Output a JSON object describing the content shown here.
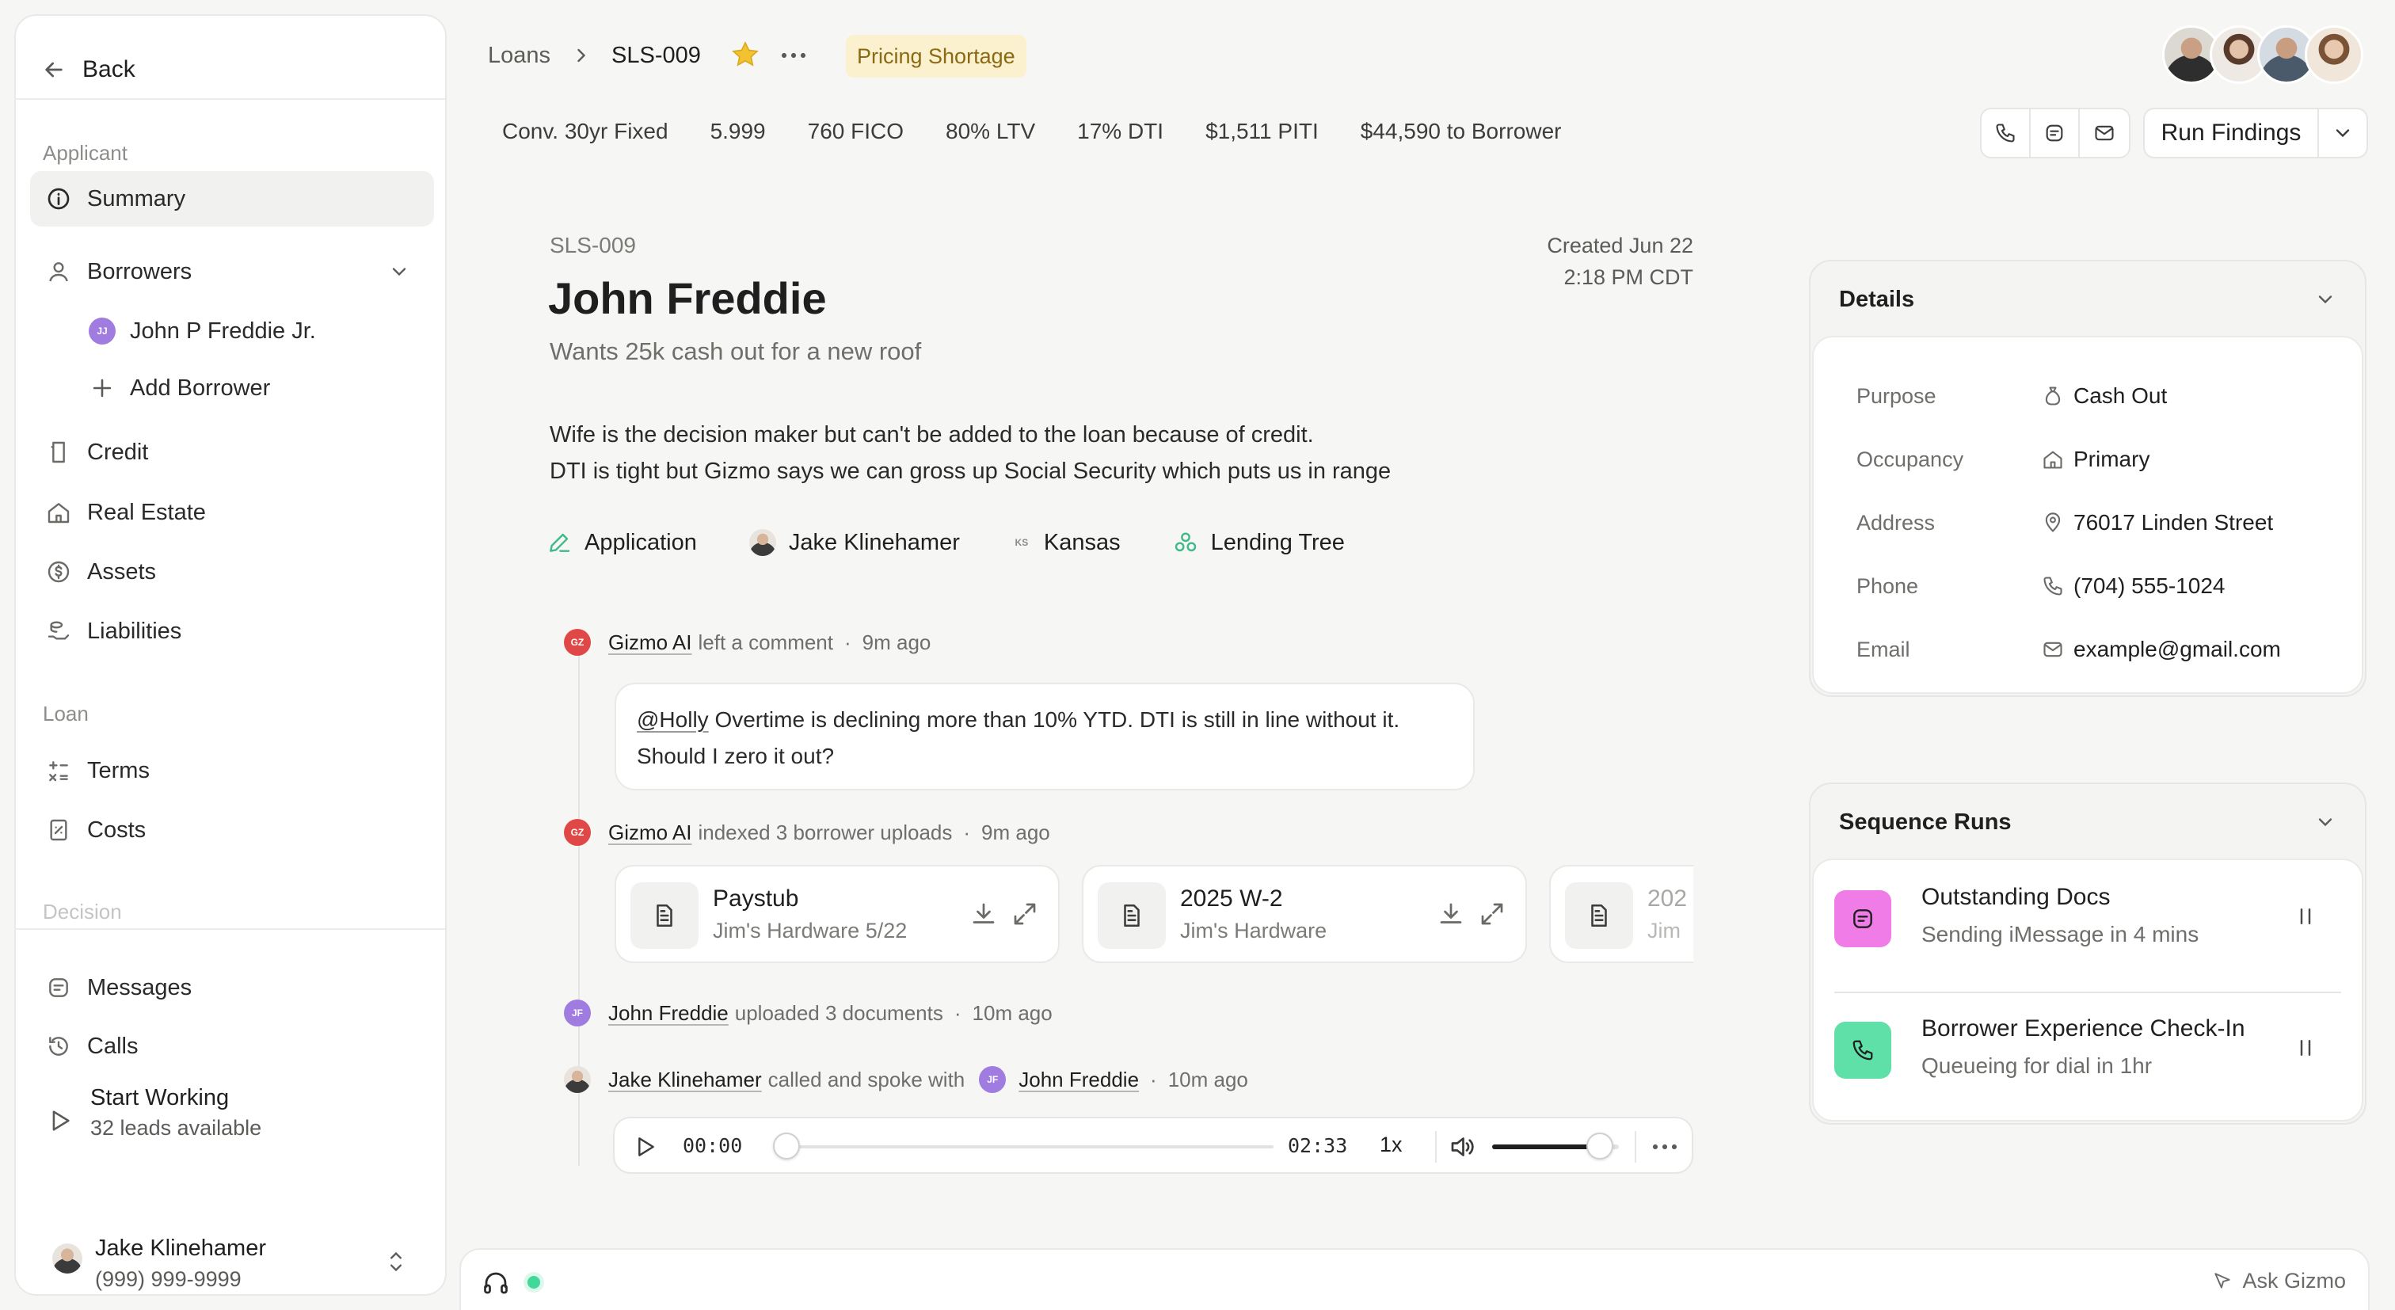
{
  "sidebar": {
    "back_label": "Back",
    "sections": {
      "applicant": "Applicant",
      "loan": "Loan",
      "decision": "Decision"
    },
    "items": {
      "summary": "Summary",
      "borrowers": "Borrowers",
      "borrower_name": "John P Freddie Jr.",
      "borrower_initials": "JJ",
      "add_borrower": "Add Borrower",
      "credit": "Credit",
      "real_estate": "Real Estate",
      "assets": "Assets",
      "liabilities": "Liabilities",
      "terms": "Terms",
      "costs": "Costs",
      "messages": "Messages",
      "calls": "Calls"
    },
    "start_working": {
      "title": "Start Working",
      "subtitle": "32 leads available"
    },
    "user": {
      "name": "Jake Klinehamer",
      "phone": "(999) 999-9999"
    }
  },
  "header": {
    "breadcrumb_root": "Loans",
    "breadcrumb_current": "SLS-009",
    "status_badge": "Pricing Shortage",
    "stats": [
      "Conv. 30yr Fixed",
      "5.999",
      "760 FICO",
      "80% LTV",
      "17% DTI",
      "$1,511 PITI",
      "$44,590 to Borrower"
    ],
    "run_findings": "Run Findings"
  },
  "loan": {
    "id": "SLS-009",
    "created_line1": "Created Jun 22",
    "created_line2": "2:18 PM CDT",
    "name": "John Freddie",
    "summary": "Wants 25k cash out for a new roof",
    "note_line1": "Wife is the decision maker but can't be added to the loan because of credit.",
    "note_line2": "DTI is tight but Gizmo says we can gross up Social Security which puts us in range",
    "tags": {
      "application": "Application",
      "officer": "Jake Klinehamer",
      "state_abbr": "KS",
      "state": "Kansas",
      "source": "Lending Tree"
    }
  },
  "activity": {
    "e1": {
      "initials": "GZ",
      "actor": "Gizmo AI",
      "action": "left a comment",
      "time": "9m ago"
    },
    "comment": {
      "mention": "@Holly",
      "text": " Overtime is declining more than 10% YTD. DTI is still in line without it. Should I zero it out?"
    },
    "e2": {
      "initials": "GZ",
      "actor": "Gizmo AI",
      "action": "indexed 3 borrower uploads",
      "time": "9m ago"
    },
    "files": [
      {
        "name": "Paystub",
        "sub": "Jim's Hardware 5/22"
      },
      {
        "name": "2025 W-2",
        "sub": "Jim's Hardware"
      },
      {
        "name": "202",
        "sub": "Jim"
      }
    ],
    "e3": {
      "initials": "JF",
      "actor": "John Freddie",
      "action": "uploaded 3 documents",
      "time": "10m ago"
    },
    "e4": {
      "actor": "Jake Klinehamer",
      "action": "called and spoke with",
      "target_initials": "JF",
      "target": "John Freddie",
      "time": "10m ago"
    },
    "player": {
      "current": "00:00",
      "duration": "02:33",
      "speed": "1x",
      "progress": 0,
      "volume": 0.85
    }
  },
  "details": {
    "title": "Details",
    "rows": {
      "purpose": {
        "label": "Purpose",
        "value": "Cash Out"
      },
      "occupancy": {
        "label": "Occupancy",
        "value": "Primary"
      },
      "address": {
        "label": "Address",
        "value": "76017 Linden Street"
      },
      "phone": {
        "label": "Phone",
        "value": "(704) 555-1024"
      },
      "email": {
        "label": "Email",
        "value": "example@gmail.com"
      }
    }
  },
  "sequences": {
    "title": "Sequence Runs",
    "items": [
      {
        "title": "Outstanding Docs",
        "sub": "Sending iMessage in 4 mins",
        "color": "#f07ce8"
      },
      {
        "title": "Borrower Experience Check-In",
        "sub": "Queueing for dial in 1hr",
        "color": "#5fe0a8"
      }
    ]
  },
  "bottom": {
    "ask": "Ask Gizmo"
  },
  "colors": {
    "badge_bg": "#fbf1cf",
    "badge_text": "#8a6a12",
    "star": "#f2c230",
    "online": "#43d89a"
  }
}
